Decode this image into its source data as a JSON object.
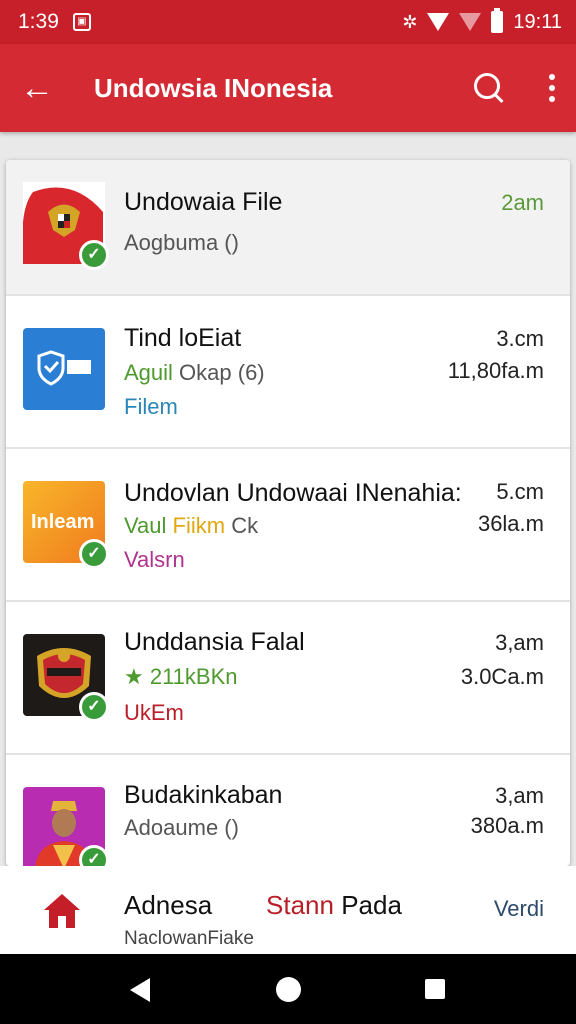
{
  "status_bar": {
    "time_left": "1:39",
    "time_right": "19:11"
  },
  "app_bar": {
    "title": "Undowsia INonesia"
  },
  "files": [
    {
      "title": "Undowaia File",
      "subtitle": "Aogbuma ()",
      "time": "2am",
      "size": "",
      "extra": "",
      "time_color": "#5b9a3b"
    },
    {
      "title": "Tind loEiat",
      "subtitle_green": "Aguil",
      "subtitle": "Okap (6)",
      "time": "3.cm",
      "size": "11,80fa.m",
      "extra": "Filem",
      "extra_color": "#2b86b8"
    },
    {
      "title": "Undovlan Undowaai INenahia:",
      "subtitle_green": "Vaul",
      "subtitle_yellow": "Fiikm",
      "subtitle": "Ck",
      "time": "5.cm",
      "size": "36la.m",
      "extra": "Valsrn",
      "extra_color": "#b0338f"
    },
    {
      "title": "Unddansia Falal",
      "subtitle_green": "★ 211kBKn",
      "subtitle": "",
      "time": "3,am",
      "size": "3.0Ca.m",
      "extra": "UkEm",
      "extra_color": "#b81f28"
    },
    {
      "title": "Budakinkaban",
      "subtitle": "Adoaume ()",
      "time": "3,am",
      "size": "380a.m",
      "extra": ""
    }
  ],
  "bottom_bar": {
    "title": "Adnesa",
    "status": "Stann",
    "status_suffix": "Pada",
    "subtitle": "NaclowanFiake",
    "action": "Verdi"
  }
}
